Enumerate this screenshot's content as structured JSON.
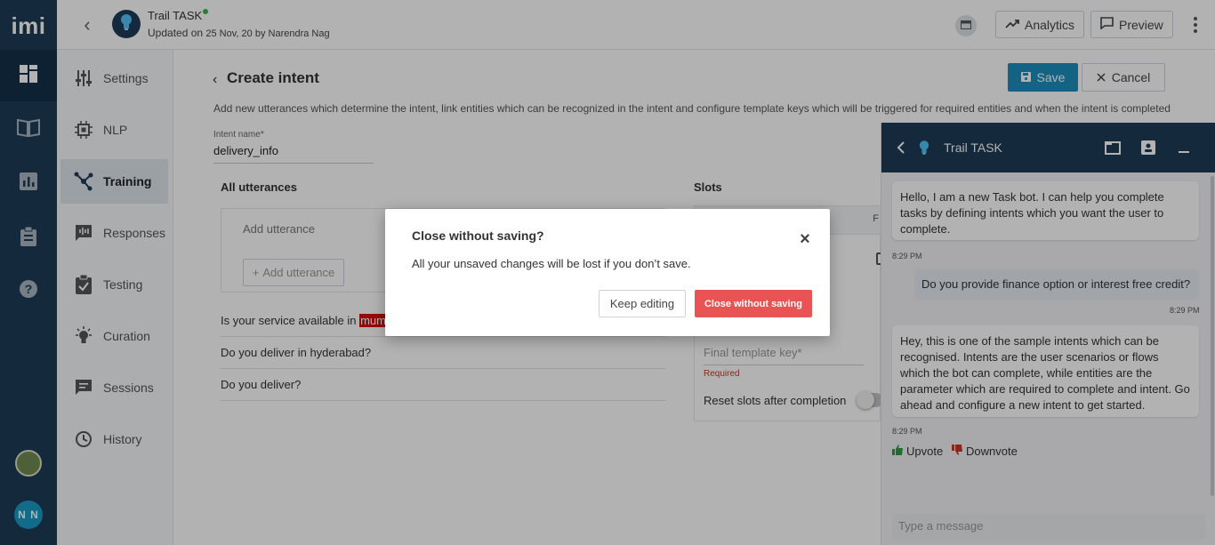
{
  "app": {
    "logo": "imi"
  },
  "header": {
    "bot_name": "Trail TASK",
    "updated_prefix": "Updated on ",
    "updated_date": "25 Nov, 20 by Narendra Nag",
    "analytics_label": "Analytics",
    "preview_label": "Preview"
  },
  "user": {
    "initials": "N N"
  },
  "subnav": {
    "items": [
      {
        "label": "Settings"
      },
      {
        "label": "NLP"
      },
      {
        "label": "Training"
      },
      {
        "label": "Responses"
      },
      {
        "label": "Testing"
      },
      {
        "label": "Curation"
      },
      {
        "label": "Sessions"
      },
      {
        "label": "History"
      }
    ]
  },
  "page": {
    "title": "Create intent",
    "save_label": "Save",
    "cancel_label": "Cancel",
    "description": "Add new utterances which determine the intent, link entities which can be recognized in the intent and configure template keys which will be triggered for required entities and when the intent is completed",
    "intent_name_label": "Intent name*",
    "intent_name_value": "delivery_info",
    "all_utterances_title": "All utterances",
    "add_utterance_placeholder": "Add utterance",
    "add_utterance_button": "Add utterance",
    "utterances": [
      {
        "text_before": "Is your service available in ",
        "highlight": "mum"
      },
      {
        "text": "Do you deliver in hyderabad?"
      },
      {
        "text": "Do you deliver?"
      }
    ],
    "slots_title": "Slots",
    "slots_header_partial": "F",
    "final_template_key_label": "Final template key*",
    "required_text": "Required",
    "reset_slots_label": "Reset slots after completion"
  },
  "chat": {
    "title": "Trail TASK",
    "messages": [
      {
        "from": "bot",
        "text": "Hello, I am a new Task bot. I can help you complete tasks by defining intents which you want the user to complete.",
        "time": "8:29 PM"
      },
      {
        "from": "user",
        "text": "Do you provide finance option or interest free credit?",
        "time": "8:29 PM"
      },
      {
        "from": "bot",
        "text": "Hey, this is one of the sample intents which can be recognised. Intents are the user scenarios or flows which the bot can complete, while entities are the parameter which are required to complete and intent. Go ahead and configure a new intent to get started.",
        "time": "8:29 PM"
      }
    ],
    "upvote_label": "Upvote",
    "downvote_label": "Downvote",
    "input_placeholder": "Type a message"
  },
  "modal": {
    "title": "Close without saving?",
    "body": "All your unsaved changes will be lost if you don’t save.",
    "keep_editing_label": "Keep editing",
    "close_without_saving_label": "Close without saving"
  },
  "colors": {
    "rail": "#1d3b57",
    "primary": "#1d8fbf",
    "danger": "#e95353",
    "highlight": "#d70e0e"
  }
}
